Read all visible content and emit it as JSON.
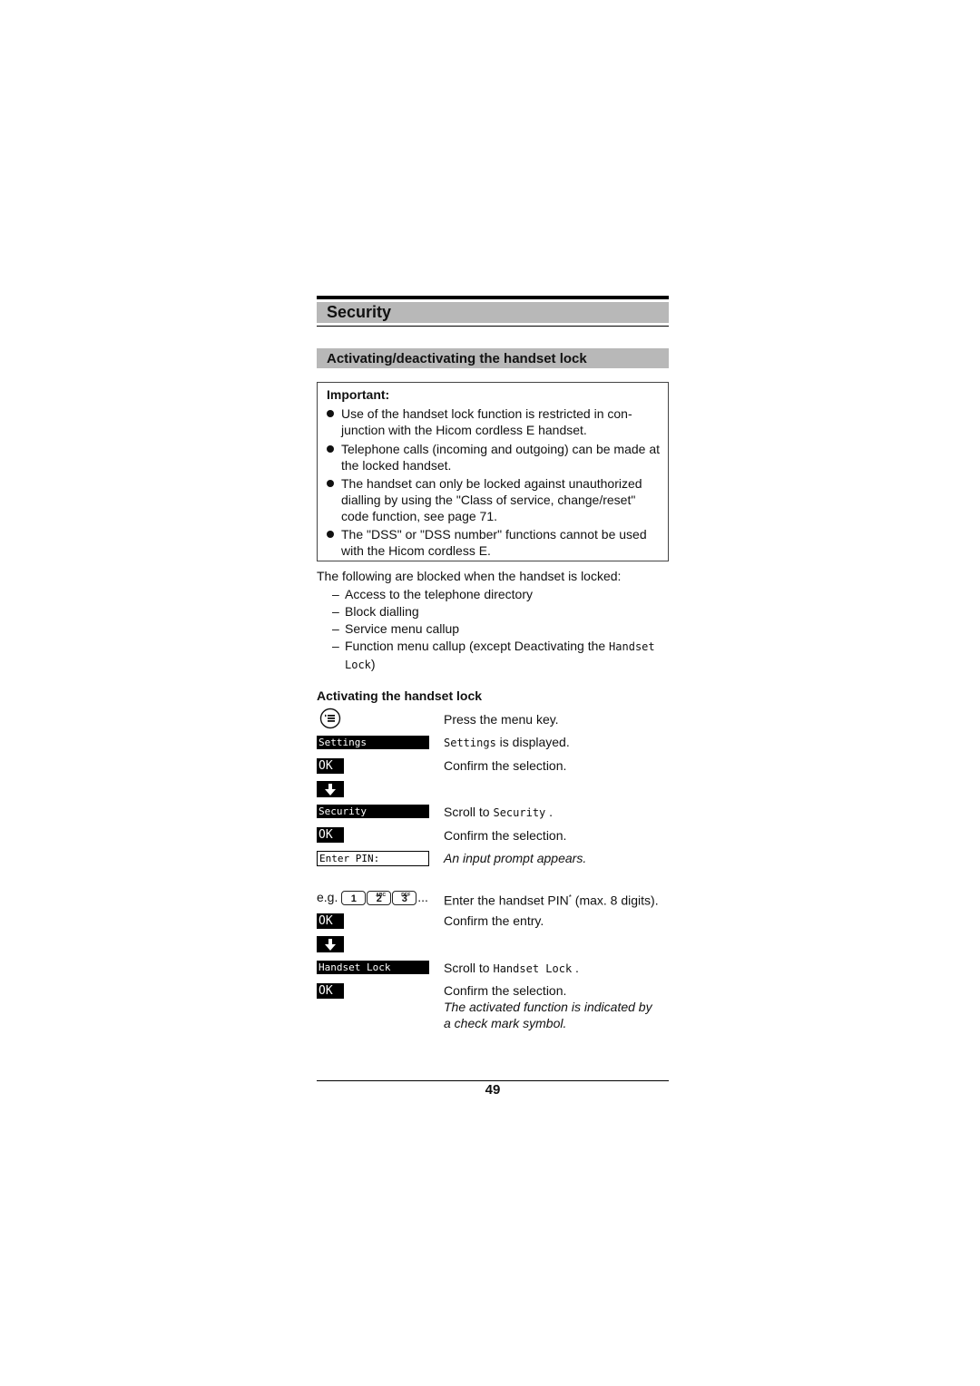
{
  "section_title": "Security",
  "subsection_title": "Activating/deactivating the handset lock",
  "important": {
    "heading": "Important:",
    "bullets": [
      "Use of the handset lock function is restricted in con- junction with the Hicom cordless E handset.",
      "Telephone calls (incoming and outgoing) can be made at the locked handset.",
      "The handset can only be locked against unauthorized dialling by using the \"Class of service, change/reset\" code function, see page 71.",
      "The \"DSS\" or \"DSS number\" functions cannot be used with the Hicom cordless E."
    ]
  },
  "blocked": {
    "intro": "The following are blocked when the handset is locked:",
    "items": [
      "Access to the telephone directory",
      "Block dialling",
      "Service menu callup"
    ],
    "last_item_prefix": "Function menu callup (except Deactivating the ",
    "last_item_lcd": "Handset Lock",
    "last_item_suffix": ")"
  },
  "procedure": {
    "heading": "Activating the handset lock",
    "icons": {
      "menu_key": "menu-key-icon",
      "down_arrow": "arrow-down-icon"
    },
    "lcd": {
      "settings": "Settings",
      "security": "Security",
      "enter_pin": "Enter PIN:",
      "handset_lock": "Handset Lock",
      "ok": "OK"
    },
    "eg_label": "e.g.",
    "keys": [
      {
        "digit": "1",
        "letters": ""
      },
      {
        "digit": "2",
        "letters": "ABC"
      },
      {
        "digit": "3",
        "letters": "DEF"
      }
    ],
    "ellipsis": "...",
    "steps": {
      "press_menu": "Press the menu key.",
      "settings_displayed_lcd": "Settings",
      "settings_displayed": " is displayed.",
      "confirm_selection_1": "Confirm the selection.",
      "scroll_to_1": "Scroll to ",
      "scroll_to_1_lcd": "Security",
      "scroll_to_1_end": " .",
      "confirm_selection_2": "Confirm the selection.",
      "input_prompt": "An input prompt appears.",
      "enter_pin": "Enter the handset PIN",
      "enter_pin_sup": "*",
      "enter_pin_end": " (max. 8 digits).",
      "confirm_entry": "Confirm the entry.",
      "scroll_to_2": "Scroll to ",
      "scroll_to_2_lcd": "Handset Lock",
      "scroll_to_2_end": " .",
      "confirm_selection_3": "Confirm the selection.",
      "result_line1": "The activated function is indicated by",
      "result_line2": "a check mark symbol."
    }
  },
  "page_number": "49"
}
